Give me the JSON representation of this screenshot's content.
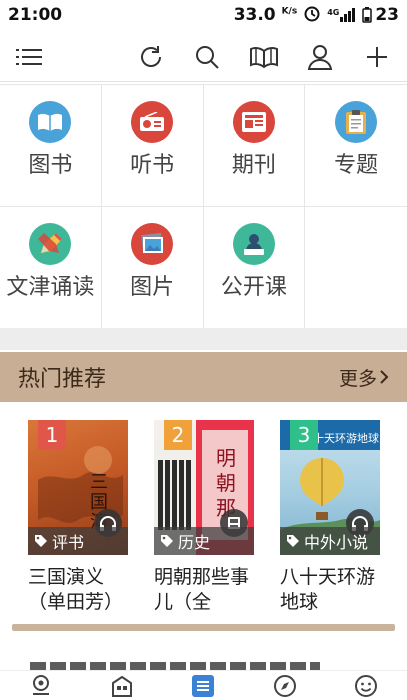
{
  "status_bar": {
    "time": "21:00",
    "speed": "33.0",
    "speed_unit": "K/s",
    "network": "4G",
    "battery": "23"
  },
  "toolbar": {
    "icons": [
      "menu-icon",
      "refresh-icon",
      "search-icon",
      "bookshelf-icon",
      "user-icon",
      "add-icon"
    ]
  },
  "categories": [
    {
      "label": "图书",
      "icon": "book-icon",
      "color": "#4aa3d8"
    },
    {
      "label": "听书",
      "icon": "radio-icon",
      "color": "#d9463b"
    },
    {
      "label": "期刊",
      "icon": "newspaper-icon",
      "color": "#d9463b"
    },
    {
      "label": "专题",
      "icon": "clipboard-icon",
      "color": "#4aa3d8"
    },
    {
      "label": "文津诵读",
      "icon": "pencil-icon",
      "color": "#3fb89a"
    },
    {
      "label": "图片",
      "icon": "picture-icon",
      "color": "#d9463b"
    },
    {
      "label": "公开课",
      "icon": "lecturer-icon",
      "color": "#3fb89a"
    }
  ],
  "hot": {
    "title": "热门推荐",
    "more": "更多",
    "books": [
      {
        "rank": "1",
        "rank_color": "#e0574a",
        "tag": "评书",
        "title": "三国演义（单田芳）",
        "badge": "headphone-icon"
      },
      {
        "rank": "2",
        "rank_color": "#f0a13a",
        "tag": "历史",
        "title": "明朝那些事儿（全",
        "badge": "book-icon"
      },
      {
        "rank": "3",
        "rank_color": "#2fbf8a",
        "tag": "中外小说",
        "title": "八十天环游地球",
        "badge": "headphone-icon"
      }
    ]
  },
  "bottom_nav": [
    "location-icon",
    "library-icon",
    "list-icon",
    "compass-icon",
    "smile-icon"
  ]
}
